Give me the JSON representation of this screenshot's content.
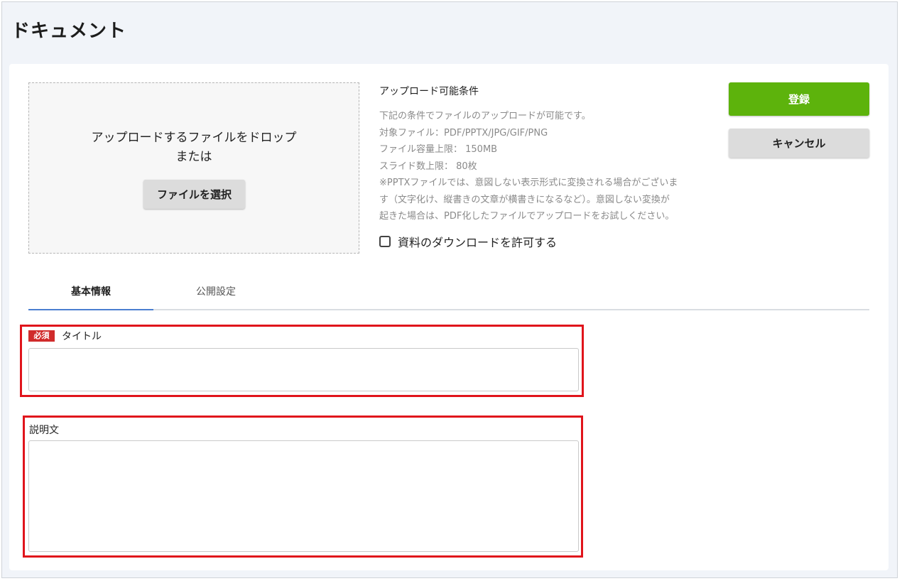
{
  "page": {
    "title": "ドキュメント"
  },
  "upload": {
    "drop_text": "アップロードするファイルをドロップ",
    "or_text": "または",
    "select_button": "ファイルを選択"
  },
  "conditions": {
    "title": "アップロード可能条件",
    "lines": [
      "下記の条件でファイルのアップロードが可能です。",
      "対象ファイル：PDF/PPTX/JPG/GIF/PNG",
      "ファイル容量上限： 150MB",
      "スライド数上限： 80枚",
      "※PPTXファイルでは、意図しない表示形式に変換される場合がございま",
      "す（文字化け、縦書きの文章が横書きになるなど）。意図しない変換が",
      "起きた場合は、PDF化したファイルでアップロードをお試しください。"
    ],
    "download_checkbox_label": "資料のダウンロードを許可する",
    "download_checked": false
  },
  "actions": {
    "register": "登録",
    "cancel": "キャンセル"
  },
  "tabs": [
    {
      "label": "基本情報",
      "active": true
    },
    {
      "label": "公開設定",
      "active": false
    }
  ],
  "form": {
    "required_badge": "必須",
    "title_label": "タイトル",
    "title_value": "",
    "description_label": "説明文",
    "description_value": ""
  },
  "colors": {
    "primary": "#5db30c",
    "highlight": "#e0141b",
    "tab_active": "#4a7fd0",
    "required": "#d02b2b"
  }
}
